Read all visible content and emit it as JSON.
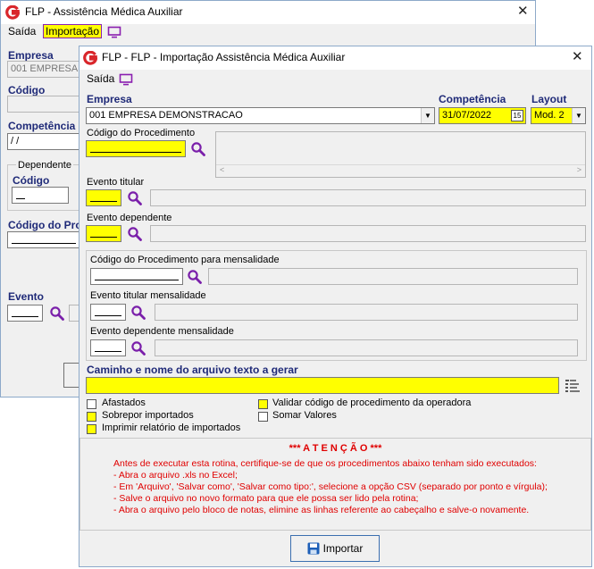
{
  "back_window": {
    "title": "FLP - Assistência Médica Auxiliar",
    "menu": {
      "saida": "Saída",
      "importacao": "Importação"
    },
    "empresa_label": "Empresa",
    "empresa_value": "001 EMPRESA",
    "codigo_label": "Código",
    "competencia_label": "Competência",
    "competencia_value": " / /",
    "dependente_group": "Dependente",
    "dependente_codigo_label": "Código",
    "codigo_procedimento_label": "Código do Proce",
    "evento_label": "Evento"
  },
  "front_window": {
    "title": "FLP -  FLP - Importação Assistência Médica Auxiliar",
    "menu": {
      "saida": "Saída"
    },
    "empresa_label": "Empresa",
    "empresa_value": "001 EMPRESA DEMONSTRACAO",
    "competencia_label": "Competência",
    "competencia_value": "31/07/2022",
    "calendar_day": "15",
    "layout_label": "Layout",
    "layout_value": "Mod. 2",
    "codigo_procedimento_label": "Código do Procedimento",
    "evento_titular_label": "Evento titular",
    "evento_dependente_label": "Evento dependente",
    "proc_mensalidade_label": "Código do Procedimento para mensalidade",
    "evento_titular_mens_label": "Evento titular mensalidade",
    "evento_dependente_mens_label": "Evento dependente mensalidade",
    "caminho_label": "Caminho e nome do arquivo texto a gerar",
    "checkboxes": {
      "afastados": "Afastados",
      "sobrepor": "Sobrepor importados",
      "imprimir": "Imprimir relatório de importados",
      "validar": "Validar código de procedimento da operadora",
      "somar": "Somar Valores"
    },
    "atencao": {
      "title": "*** A T E N Ç Ã O ***",
      "intro": "Antes de executar esta rotina, certifique-se de que os procedimentos abaixo tenham sido executados:",
      "lines": [
        "- Abra o arquivo .xls no Excel;",
        "- Em 'Arquivo', 'Salvar como', 'Salvar como tipo:', selecione a opção CSV (separado por ponto e vírgula);",
        "- Salve o arquivo no novo formato para que ele possa ser lido pela rotina;",
        "- Abra o arquivo pelo bloco de notas, elimine as linhas referente ao cabeçalho e salve-o novamente."
      ]
    },
    "importar_label": "Importar"
  },
  "colors": {
    "highlight": "#ffff00",
    "label_blue": "#1f2a78",
    "warning_red": "#e00000",
    "logo_red": "#d9262b",
    "monitor_purple": "#8a1fb0"
  }
}
